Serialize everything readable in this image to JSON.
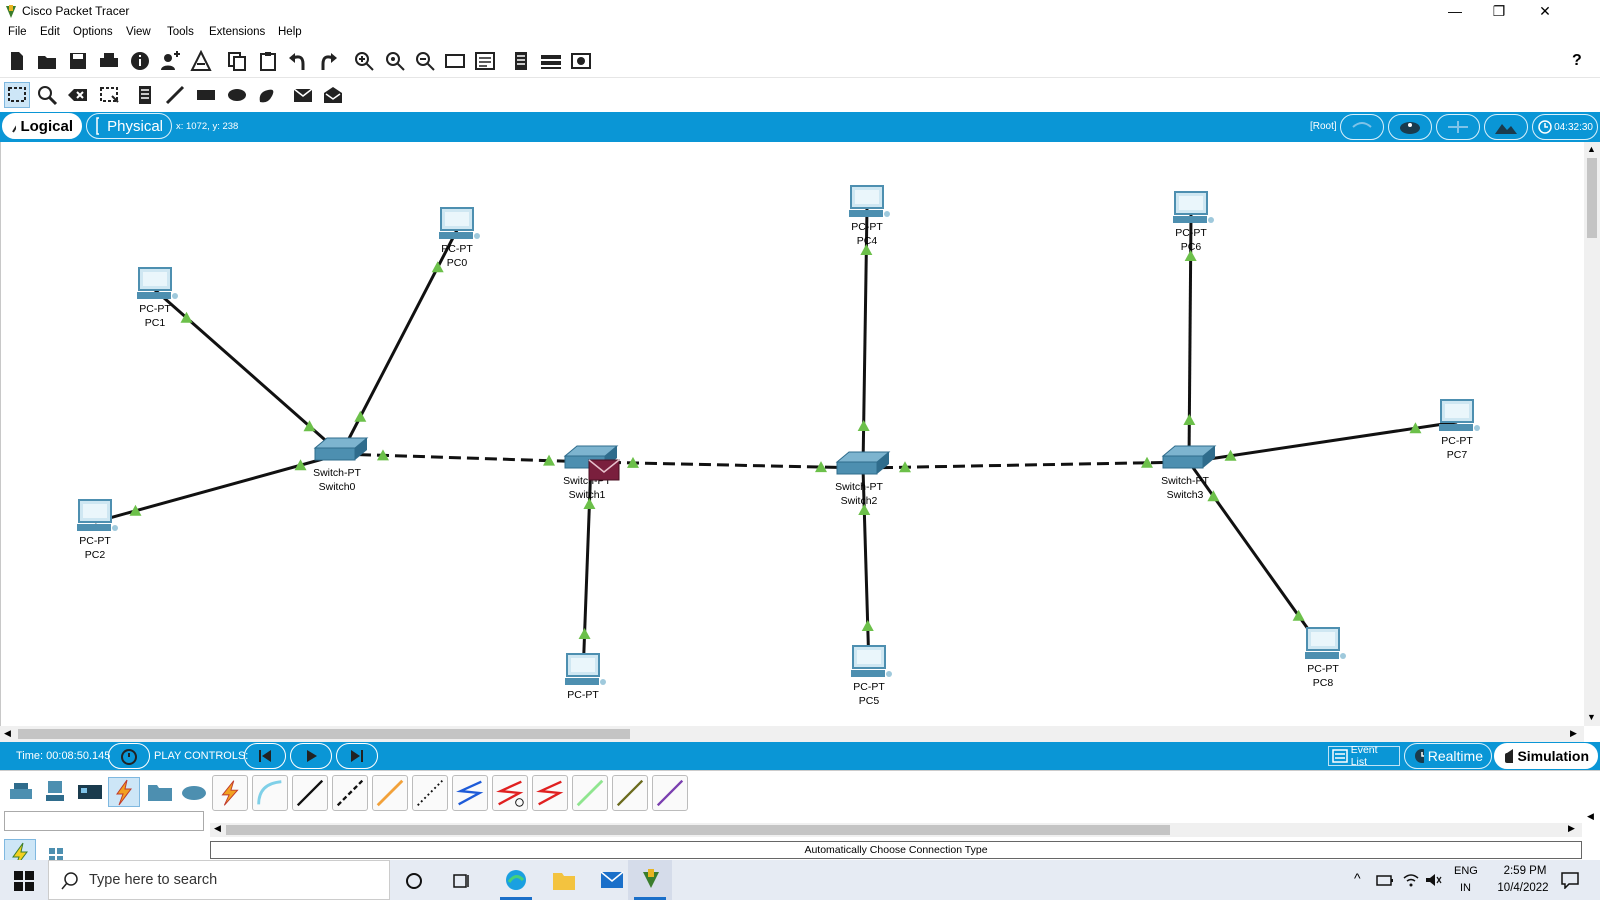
{
  "window": {
    "title": "Cisco Packet Tracer",
    "minimize": "—",
    "restore": "❐",
    "close": "✕"
  },
  "menu": [
    "File",
    "Edit",
    "Options",
    "View",
    "Tools",
    "Extensions",
    "Help"
  ],
  "toolbar": {
    "help": "?"
  },
  "tabs": {
    "logical": "Logical",
    "physical": "Physical",
    "coords": "x: 1072, y: 238",
    "root": "[Root]",
    "clock": "04:32:30"
  },
  "topology": {
    "devices": [
      {
        "id": "pc0",
        "model": "PC-PT",
        "name": "PC0"
      },
      {
        "id": "pc1",
        "model": "PC-PT",
        "name": "PC1"
      },
      {
        "id": "pc2",
        "model": "PC-PT",
        "name": "PC2"
      },
      {
        "id": "pc3",
        "model": "PC-PT",
        "name": ""
      },
      {
        "id": "pc4",
        "model": "PC-PT",
        "name": "PC4"
      },
      {
        "id": "pc5",
        "model": "PC-PT",
        "name": "PC5"
      },
      {
        "id": "pc6",
        "model": "PC-PT",
        "name": "PC6"
      },
      {
        "id": "pc7",
        "model": "PC-PT",
        "name": "PC7"
      },
      {
        "id": "pc8",
        "model": "PC-PT",
        "name": "PC8"
      },
      {
        "id": "sw0",
        "model": "Switch-PT",
        "name": "Switch0"
      },
      {
        "id": "sw1",
        "model": "Switch-PT",
        "name": "Switch1"
      },
      {
        "id": "sw2",
        "model": "Switch-PT",
        "name": "Switch2"
      },
      {
        "id": "sw3",
        "model": "Switch-PT",
        "name": "Switch3"
      }
    ],
    "links": [
      {
        "from": "pc1",
        "to": "sw0",
        "type": "straight"
      },
      {
        "from": "pc0",
        "to": "sw0",
        "type": "straight"
      },
      {
        "from": "pc2",
        "to": "sw0",
        "type": "straight"
      },
      {
        "from": "sw0",
        "to": "sw1",
        "type": "crossover"
      },
      {
        "from": "sw1",
        "to": "pc3",
        "type": "straight"
      },
      {
        "from": "sw1",
        "to": "sw2",
        "type": "crossover"
      },
      {
        "from": "pc4",
        "to": "sw2",
        "type": "straight"
      },
      {
        "from": "sw2",
        "to": "pc5",
        "type": "straight"
      },
      {
        "from": "sw2",
        "to": "sw3",
        "type": "crossover"
      },
      {
        "from": "pc6",
        "to": "sw3",
        "type": "straight"
      },
      {
        "from": "sw3",
        "to": "pc7",
        "type": "straight"
      },
      {
        "from": "sw3",
        "to": "pc8",
        "type": "straight"
      }
    ]
  },
  "simulation": {
    "time": "Time: 00:08:50.145",
    "play_controls": "PLAY CONTROLS:",
    "event_list": "Event List",
    "realtime": "Realtime",
    "simulation": "Simulation"
  },
  "bottom": {
    "status": "Automatically Choose Connection Type",
    "cable_tools": [
      "automatic",
      "console",
      "straight-through",
      "cross-over",
      "fiber",
      "phone",
      "coaxial",
      "serial-dce",
      "serial-dte",
      "octal",
      "iot",
      "usb"
    ]
  },
  "taskbar": {
    "search_placeholder": "Type here to search",
    "lang1": "ENG",
    "lang2": "IN",
    "time": "2:59 PM",
    "date": "10/4/2022"
  },
  "colors": {
    "accent": "#0a96d6",
    "link_up": "#6cc04a",
    "switch": "#4d8fb0"
  }
}
